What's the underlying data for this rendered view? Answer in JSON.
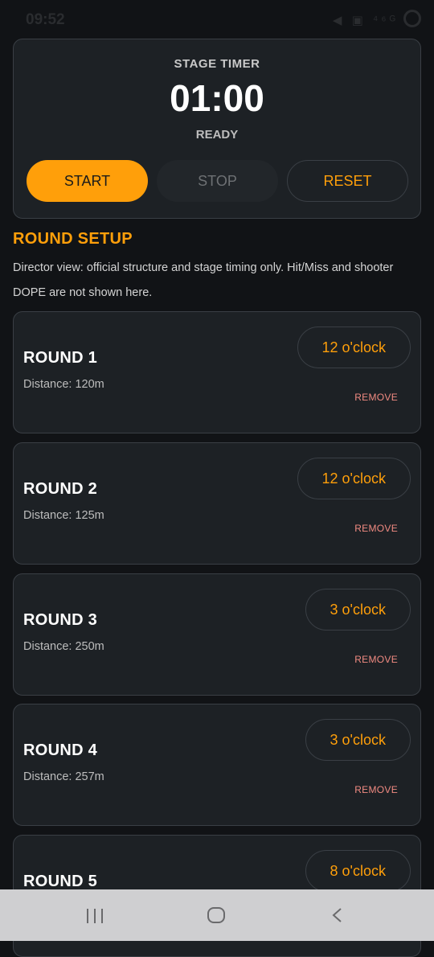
{
  "status_bar": {
    "time": "09:52",
    "icons_text": "◀ ▣ ⁴⁶ᴳ",
    "icons": [
      "mute-icon",
      "wifi-icon",
      "signal-icon",
      "app-icon"
    ]
  },
  "timer": {
    "title": "STAGE TIMER",
    "value": "01:00",
    "status": "READY",
    "start_label": "START",
    "stop_label": "STOP",
    "reset_label": "RESET"
  },
  "round_setup": {
    "title": "ROUND SETUP",
    "description": "Director view: official structure and stage timing only. Hit/Miss and shooter DOPE are not shown here.",
    "rounds": [
      {
        "name": "ROUND 1",
        "distance": "Distance: 120m",
        "clock": "12 o'clock",
        "remove": "REMOVE"
      },
      {
        "name": "ROUND 2",
        "distance": "Distance: 125m",
        "clock": "12 o'clock",
        "remove": "REMOVE"
      },
      {
        "name": "ROUND 3",
        "distance": "Distance: 250m",
        "clock": "3 o'clock",
        "remove": "REMOVE"
      },
      {
        "name": "ROUND 4",
        "distance": "Distance: 257m",
        "clock": "3 o'clock",
        "remove": "REMOVE"
      },
      {
        "name": "ROUND 5",
        "distance": "",
        "clock": "8 o'clock",
        "remove": ""
      }
    ]
  },
  "colors": {
    "accent": "#ff9f0a",
    "card": "#1d2125",
    "background": "#111316",
    "remove": "#f28b82"
  }
}
